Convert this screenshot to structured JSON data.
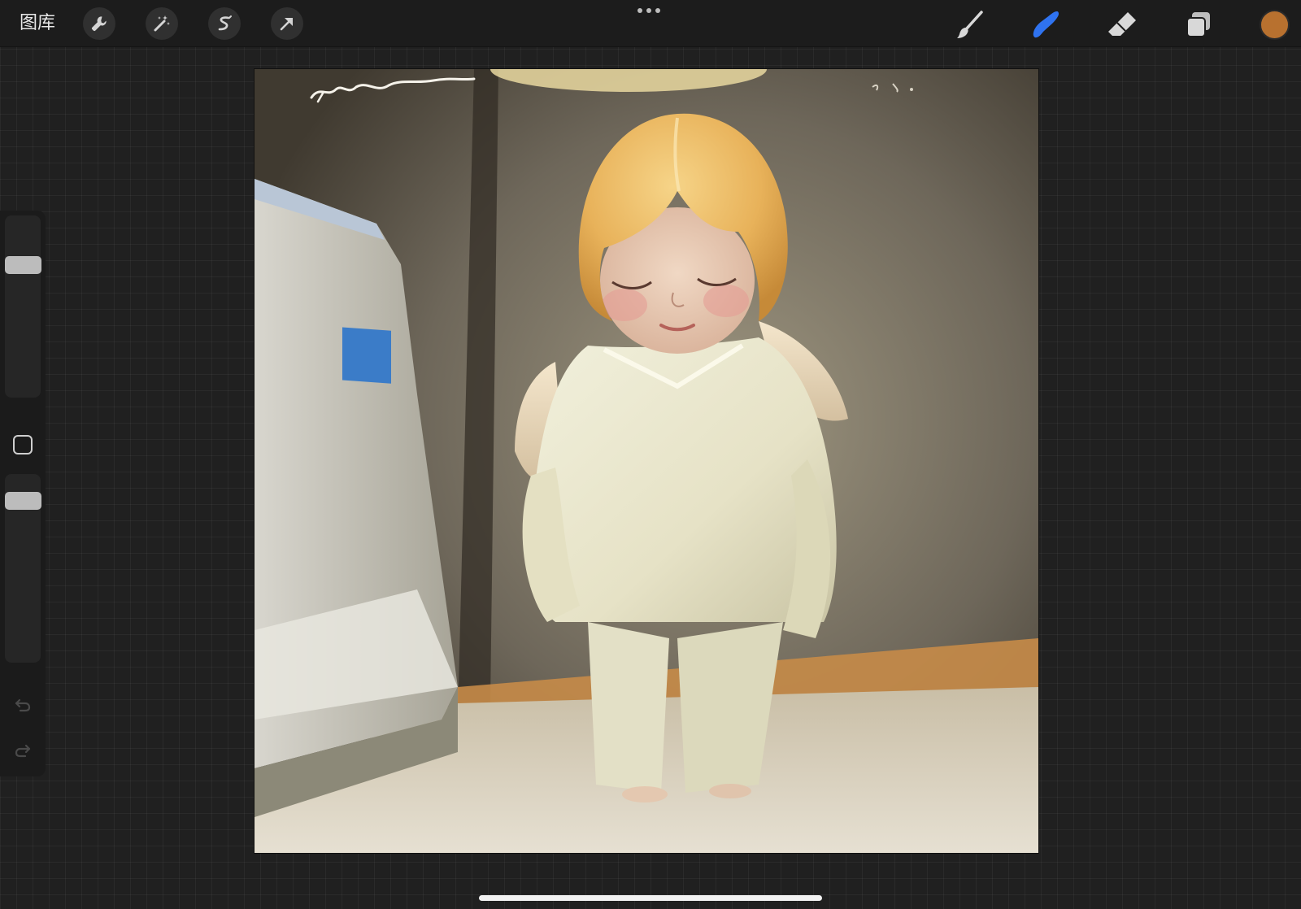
{
  "app": {
    "gallery_label": "图库"
  },
  "topbar": {
    "left_tools": [
      {
        "name": "actions",
        "icon": "wrench-icon"
      },
      {
        "name": "adjustments",
        "icon": "magic-wand-icon"
      },
      {
        "name": "selection",
        "icon": "selection-s-icon"
      },
      {
        "name": "transform",
        "icon": "arrow-cursor-icon"
      }
    ],
    "right_tools": [
      {
        "name": "paint",
        "icon": "brush-icon",
        "active": false
      },
      {
        "name": "smudge",
        "icon": "smudge-finger-icon",
        "active": true
      },
      {
        "name": "erase",
        "icon": "eraser-icon",
        "active": false
      },
      {
        "name": "layers",
        "icon": "layers-icon",
        "active": false
      }
    ],
    "active_tool_color": "#2f73f0",
    "current_color": "#b8712f"
  },
  "sidebar": {
    "brush_size_level": 0.85,
    "opacity_level": 0.92
  },
  "canvas": {
    "artwork": "angel-child-painting",
    "signature": "yunny",
    "date_mark": "1. 6."
  }
}
